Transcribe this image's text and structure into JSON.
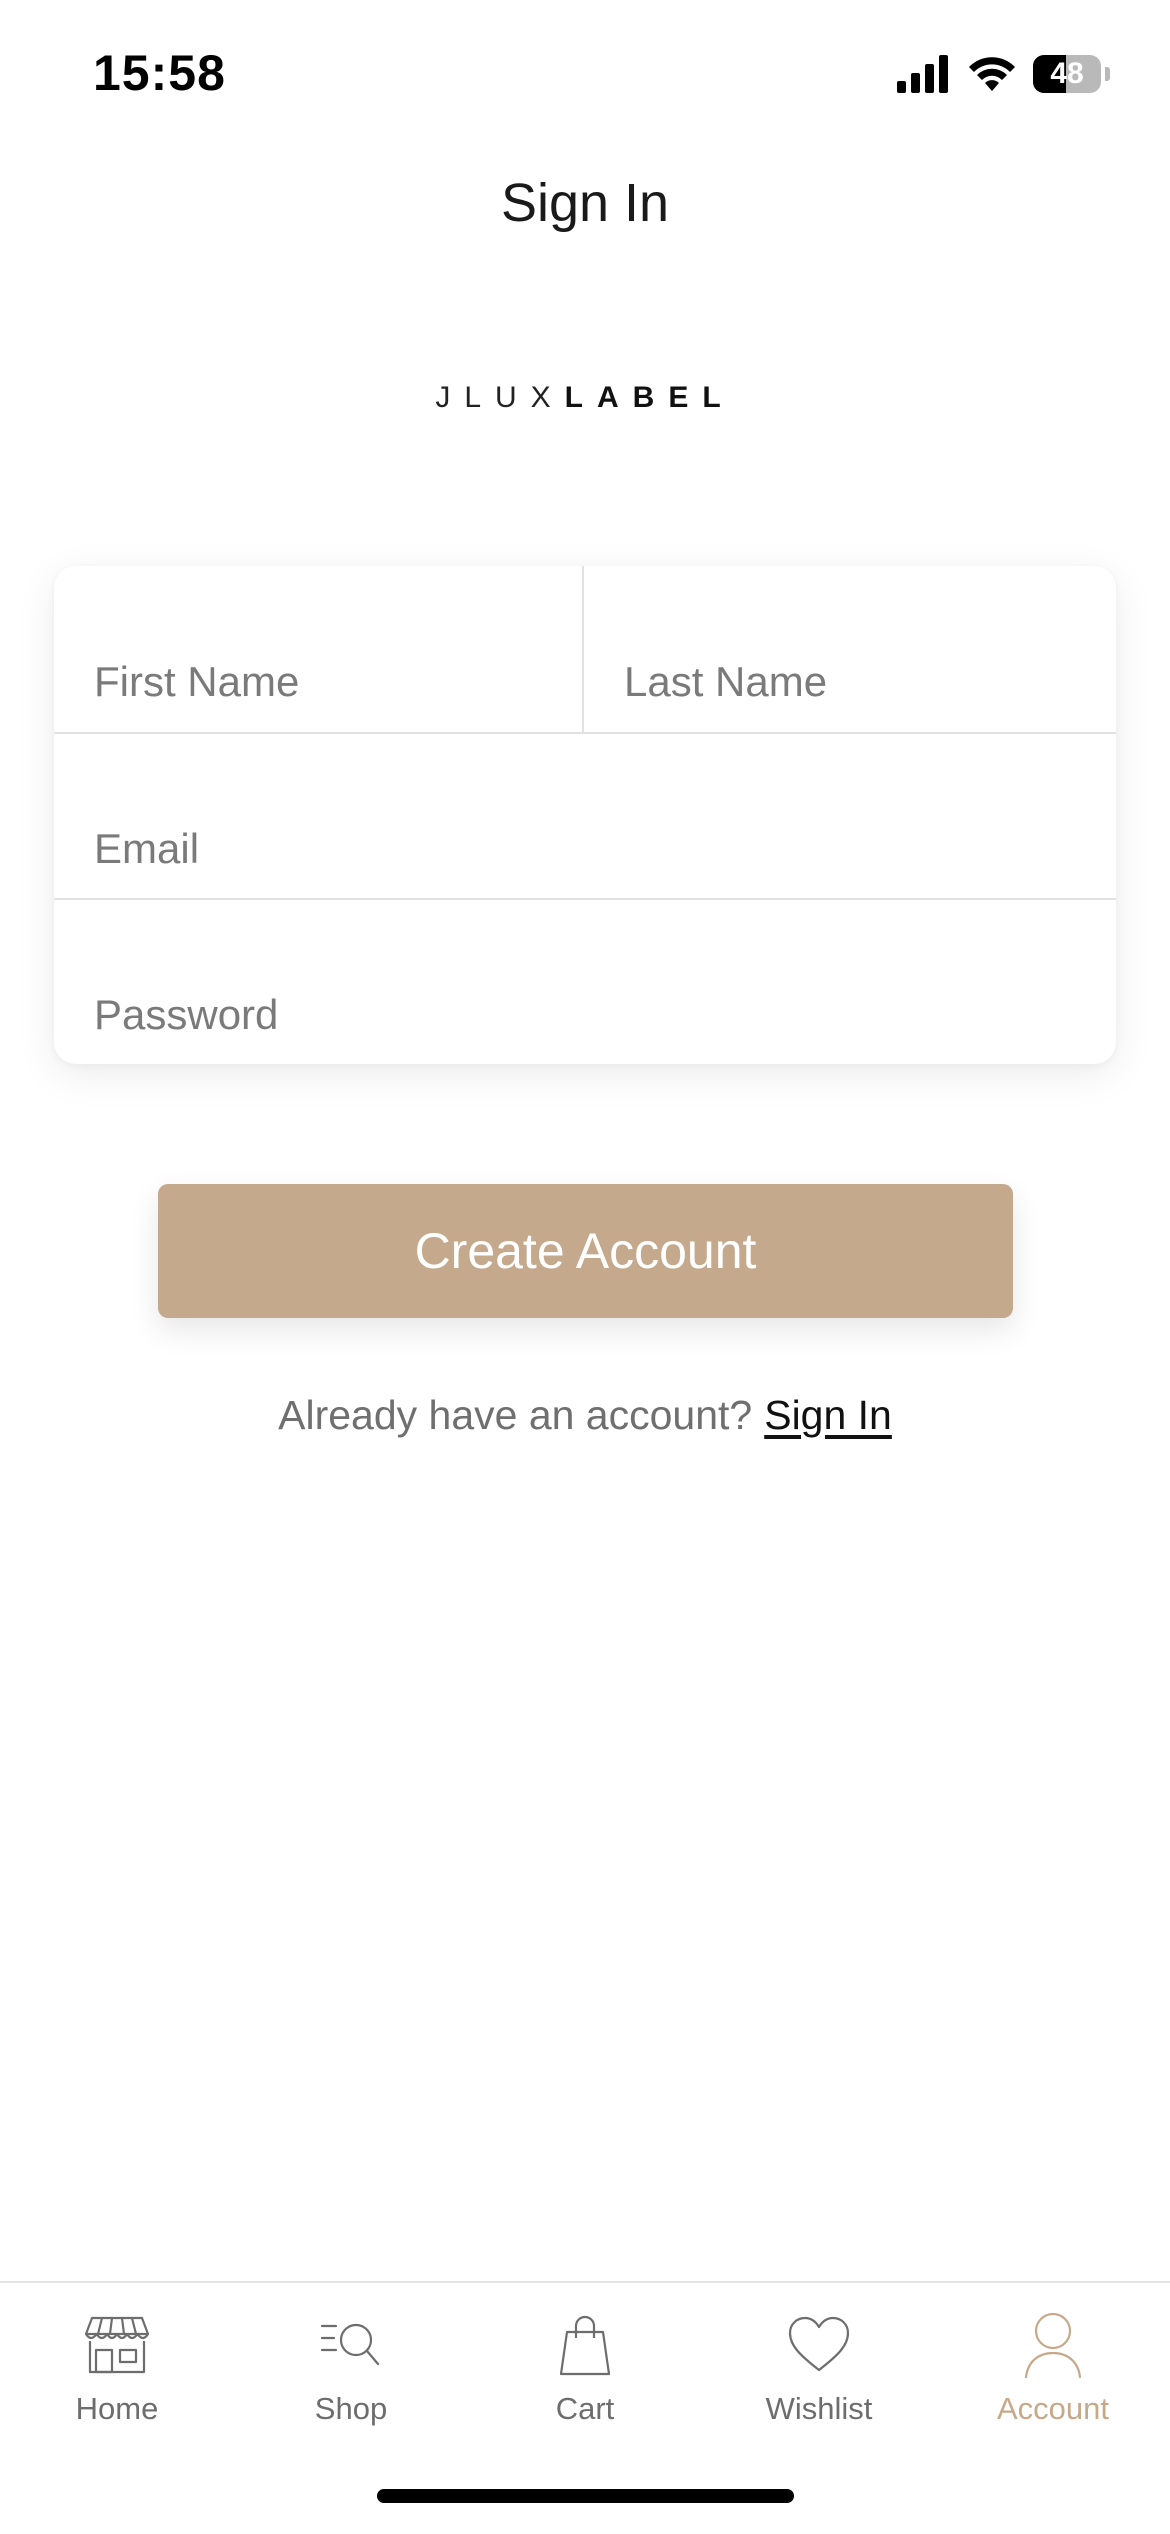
{
  "status_bar": {
    "time": "15:58",
    "battery": 48
  },
  "header": {
    "title": "Sign In"
  },
  "logo": {
    "light_text": "JLUX",
    "bold_text": "LABEL"
  },
  "form": {
    "first_name_placeholder": "First Name",
    "last_name_placeholder": "Last Name",
    "email_placeholder": "Email",
    "password_placeholder": "Password",
    "first_name_value": "",
    "last_name_value": "",
    "email_value": "",
    "password_value": ""
  },
  "actions": {
    "create_account_label": "Create Account",
    "already_have_account_text": "Already have an account?",
    "sign_in_link": "Sign In"
  },
  "tab_bar": {
    "items": [
      {
        "label": "Home",
        "icon": "storefront-icon"
      },
      {
        "label": "Shop",
        "icon": "search-list-icon"
      },
      {
        "label": "Cart",
        "icon": "shopping-bag-icon"
      },
      {
        "label": "Wishlist",
        "icon": "heart-icon"
      },
      {
        "label": "Account",
        "icon": "person-icon"
      }
    ],
    "active": "Account"
  },
  "colors": {
    "accent": "#c4a98c",
    "active_tab": "#c7a98a",
    "muted_text": "#6d6d6d"
  }
}
